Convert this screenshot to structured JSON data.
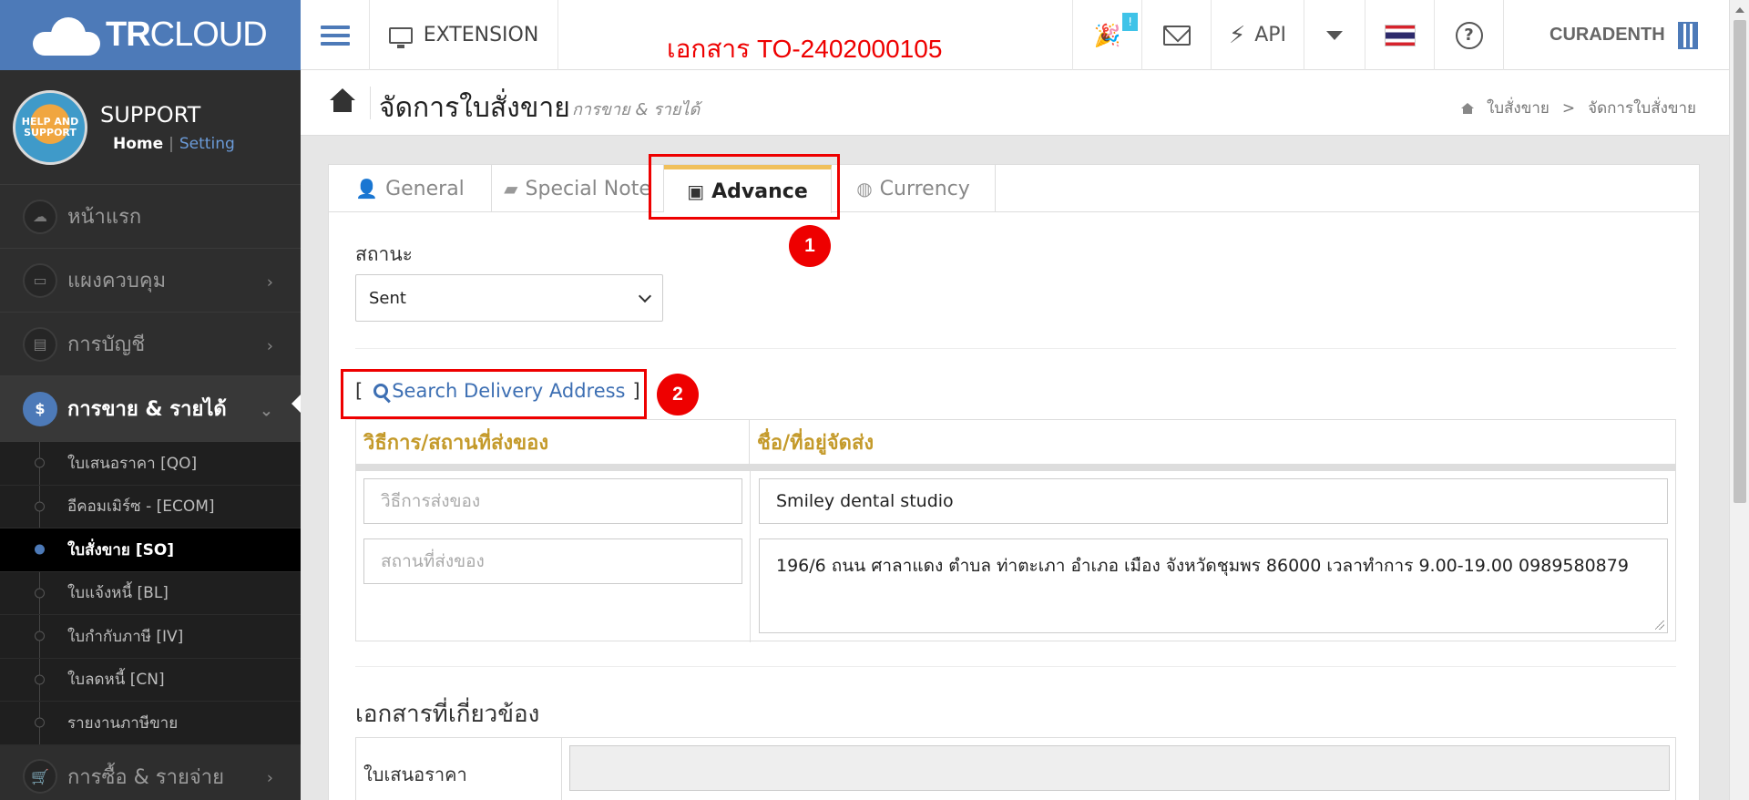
{
  "brand": {
    "bold": "TR",
    "light": "CLOUD"
  },
  "profile": {
    "avatar_text": "HELP AND SUPPORT",
    "name": "SUPPORT",
    "home": "Home",
    "separator": "|",
    "setting": "Setting"
  },
  "sidebar": {
    "menu": [
      {
        "label": "หน้าแรก",
        "icon": "cloud-icon"
      },
      {
        "label": "แผงควบคุม",
        "icon": "monitor-icon"
      },
      {
        "label": "การบัญชี",
        "icon": "book-icon"
      },
      {
        "label": "การขาย & รายได้",
        "icon": "dollar-icon"
      },
      {
        "label": "การซื้อ & รายจ่าย",
        "icon": "cart-icon"
      }
    ],
    "submenu": [
      "ใบเสนอราคา [QO]",
      "อีคอมเมิร์ซ - [ECOM]",
      "ใบสั่งขาย [SO]",
      "ใบแจ้งหนี้ [BL]",
      "ใบกำกับภาษี [IV]",
      "ใบลดหนี้ [CN]",
      "รายงานภาษีขาย"
    ],
    "dollar_glyph": "$",
    "chevron_glyph": "›",
    "cart_glyph": "🛒"
  },
  "topbar": {
    "extension": "EXTENSION",
    "document_title": "เอกสาร TO-2402000105",
    "notification_badge": "!",
    "api": "API",
    "help_glyph": "?",
    "company": "CURADENTH"
  },
  "page_header": {
    "title": "จัดการใบสั่งขาย",
    "subtitle": "การขาย & รายได้",
    "breadcrumb": [
      "ใบสั่งขาย",
      "จัดการใบสั่งขาย"
    ],
    "breadcrumb_sep": ">"
  },
  "tabs": [
    {
      "label": "General",
      "icon": "user-icon",
      "glyph": "👤"
    },
    {
      "label": "Special Note",
      "icon": "note-icon",
      "glyph": "▰"
    },
    {
      "label": "Advance",
      "icon": "tie-icon",
      "glyph": "▣"
    },
    {
      "label": "Currency",
      "icon": "globe-icon",
      "glyph": "◍"
    }
  ],
  "form": {
    "status_label": "สถานะ",
    "status_value": "Sent",
    "search_open": "[",
    "search_close": "]",
    "search_label": "Search Delivery Address",
    "col_method": "วิธีการ/สถานที่ส่งของ",
    "col_name": "ชื่อ/ที่อยู่จัดส่ง",
    "ship_method_placeholder": "วิธีการส่งของ",
    "ship_place_placeholder": "สถานที่ส่งของ",
    "ship_name": "Smiley dental studio",
    "ship_address": "196/6 ถนน ศาลาแดง ตำบล ท่าตะเภา อำเภอ เมือง จังหวัดชุมพร 86000 เวลาทำการ 9.00-19.00 0989580879",
    "related_title": "เอกสารที่เกี่ยวข้อง",
    "related_quotation": "ใบเสนอราคา"
  },
  "annotations": {
    "marker1": "1",
    "marker2": "2",
    "color": "#ee0000"
  },
  "colors": {
    "brand_blue": "#4d7ab8",
    "link_blue": "#3d6fb3",
    "header_gold": "#c49a2a",
    "tab_accent": "#f0c05a"
  }
}
